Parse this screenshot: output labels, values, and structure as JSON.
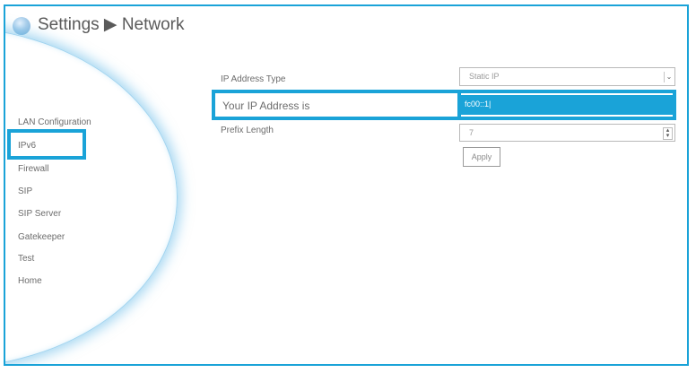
{
  "header": {
    "title": "Settings ▶ Network",
    "logo_icon": "globe-icon"
  },
  "nav": {
    "items": [
      {
        "label": "LAN Configuration"
      },
      {
        "label": "IPv6"
      },
      {
        "label": "Firewall"
      },
      {
        "label": "SIP"
      },
      {
        "label": "SIP Server"
      },
      {
        "label": "Gatekeeper"
      },
      {
        "label": "Test"
      },
      {
        "label": "Home"
      }
    ],
    "selected": "IPv6"
  },
  "form": {
    "ip_address_type": {
      "label": "IP Address Type",
      "value": "Static IP"
    },
    "your_ip": {
      "label": "Your IP Address is",
      "value": "fc00::1|"
    },
    "prefix_length": {
      "label": "Prefix Length",
      "value": "7"
    },
    "apply_label": "Apply"
  },
  "colors": {
    "accent": "#1aa3d8",
    "text": "#6c6c6c"
  }
}
